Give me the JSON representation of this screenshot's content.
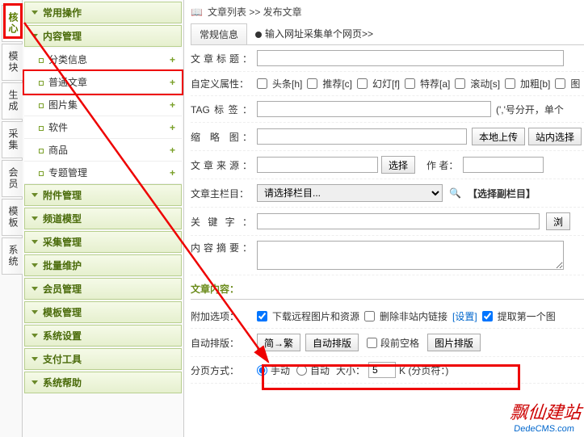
{
  "tabs": [
    "核心",
    "模块",
    "生成",
    "采集",
    "会员",
    "模板",
    "系统"
  ],
  "sidebar": {
    "groups": [
      {
        "label": "常用操作",
        "type": "group"
      },
      {
        "label": "内容管理",
        "type": "group"
      },
      {
        "label": "分类信息",
        "type": "leaf"
      },
      {
        "label": "普通文章",
        "type": "leaf",
        "highlight": true
      },
      {
        "label": "图片集",
        "type": "leaf"
      },
      {
        "label": "软件",
        "type": "leaf"
      },
      {
        "label": "商品",
        "type": "leaf"
      },
      {
        "label": "专题管理",
        "type": "leaf"
      },
      {
        "label": "附件管理",
        "type": "group"
      },
      {
        "label": "频道模型",
        "type": "group"
      },
      {
        "label": "采集管理",
        "type": "group"
      },
      {
        "label": "批量维护",
        "type": "group"
      },
      {
        "label": "会员管理",
        "type": "group"
      },
      {
        "label": "模板管理",
        "type": "group"
      },
      {
        "label": "系统设置",
        "type": "group"
      },
      {
        "label": "支付工具",
        "type": "group"
      },
      {
        "label": "系统帮助",
        "type": "group"
      }
    ]
  },
  "crumb": {
    "list": "文章列表",
    "sep": ">>",
    "current": "发布文章"
  },
  "mtabs": {
    "tab1": "常规信息",
    "tab2": "输入网址采集单个网页>>"
  },
  "form": {
    "title_label": "文章标题：",
    "attr_label": "自定义属性：",
    "attrs": [
      "头条[h]",
      "推荐[c]",
      "幻灯[f]",
      "特荐[a]",
      "滚动[s]",
      "加粗[b]",
      "图"
    ],
    "tag_label": "TAG标签：",
    "tag_hint": "(','号分开，单个",
    "thumb_label": "缩 略 图：",
    "thumb_btn1": "本地上传",
    "thumb_btn2": "站内选择",
    "source_label": "文章来源：",
    "source_btn": "选择",
    "author_label": "作  者：",
    "column_label": "文章主栏目：",
    "column_placeholder": "请选择栏目...",
    "sub_column": "【选择副栏目】",
    "keyword_label": "关键字：",
    "keyword_btn": "浏",
    "summary_label": "内容摘要：",
    "content_label": "文章内容：",
    "addon_label": "附加选项：",
    "addon1": "下载远程图片和资源",
    "addon2": "删除非站内链接",
    "addon2_set": "[设置]",
    "addon3": "提取第一个图",
    "layout_label": "自动排版：",
    "btn_simp": "简→繁",
    "btn_auto": "自动排版",
    "chk_space": "段前空格",
    "btn_pic": "图片排版",
    "page_label": "分页方式：",
    "page_manual": "手动",
    "page_auto": "自动",
    "page_size_label": "大小：",
    "page_size_value": "5",
    "page_unit": "K (分页符：)"
  },
  "watermark": {
    "main": "飘仙建站",
    "sub": "DedeCMS.com"
  }
}
